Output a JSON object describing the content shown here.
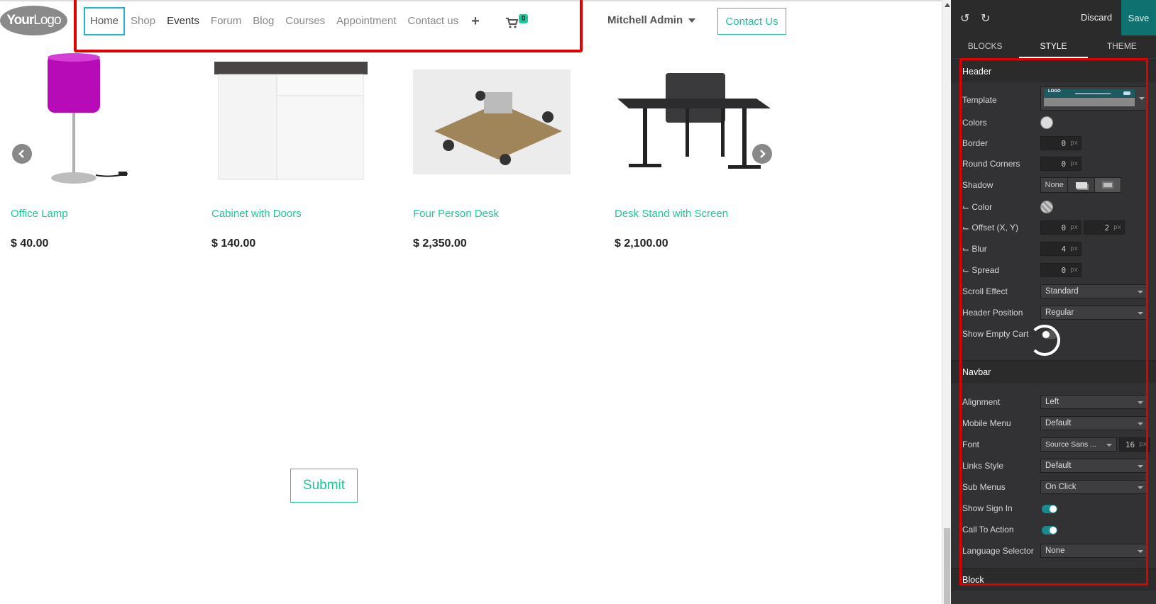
{
  "site": {
    "logo_text_bold": "Your",
    "logo_text_rest": "Logo",
    "nav": [
      {
        "label": "Home"
      },
      {
        "label": "Shop"
      },
      {
        "label": "Events"
      },
      {
        "label": "Forum"
      },
      {
        "label": "Blog"
      },
      {
        "label": "Courses"
      },
      {
        "label": "Appointment"
      },
      {
        "label": "Contact us"
      }
    ],
    "add_label": "+",
    "cart_count": "0",
    "user_name": "Mitchell Admin",
    "contact_button": "Contact Us",
    "products": [
      {
        "name": "Office Lamp",
        "price": "$ 40.00"
      },
      {
        "name": "Cabinet with Doors",
        "price": "$ 140.00"
      },
      {
        "name": "Four Person Desk",
        "price": "$ 2,350.00"
      },
      {
        "name": "Desk Stand with Screen",
        "price": "$ 2,100.00"
      }
    ],
    "submit_button": "Submit"
  },
  "editor": {
    "discard": "Discard",
    "save": "Save",
    "tabs": [
      "BLOCKS",
      "STYLE",
      "THEME"
    ],
    "header": {
      "title": "Header",
      "template_label": "Template",
      "template_preview_text": "LOGO",
      "colors_label": "Colors",
      "border_label": "Border",
      "border_value": "0",
      "round_label": "Round Corners",
      "round_value": "0",
      "shadow_label": "Shadow",
      "shadow_none": "None",
      "color_label": "⌙ Color",
      "offset_label": "⌙ Offset (X, Y)",
      "offset_x": "0",
      "offset_y": "2",
      "blur_label": "⌙ Blur",
      "blur_value": "4",
      "spread_label": "⌙ Spread",
      "spread_value": "0",
      "scroll_label": "Scroll Effect",
      "scroll_value": "Standard",
      "position_label": "Header Position",
      "position_value": "Regular",
      "empty_cart_label": "Show Empty Cart"
    },
    "navbar": {
      "title": "Navbar",
      "alignment_label": "Alignment",
      "alignment_value": "Left",
      "mobile_label": "Mobile Menu",
      "mobile_value": "Default",
      "font_label": "Font",
      "font_value": "Source Sans ...",
      "font_size": "16",
      "links_label": "Links Style",
      "links_value": "Default",
      "submenus_label": "Sub Menus",
      "submenus_value": "On Click",
      "signin_label": "Show Sign In",
      "cta_label": "Call To Action",
      "lang_label": "Language Selector",
      "lang_value": "None"
    },
    "block_title": "Block",
    "unit": "px",
    "colors": {
      "accent": "#21c69c",
      "active_border": "#1fb4c9",
      "save_bg": "#0e7370",
      "highlight": "#e00000"
    }
  }
}
